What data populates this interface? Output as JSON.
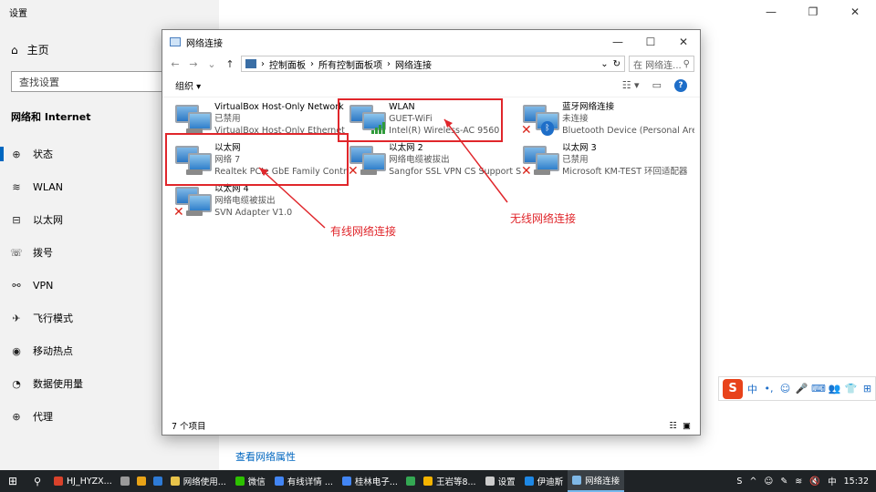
{
  "settings": {
    "title": "设置",
    "home_label": "主页",
    "search_placeholder": "查找设置",
    "section_title": "网络和 Internet",
    "nav": [
      {
        "icon": "globe-status-icon",
        "glyph": "⊕",
        "label": "状态"
      },
      {
        "icon": "wifi-icon",
        "glyph": "≋",
        "label": "WLAN"
      },
      {
        "icon": "ethernet-icon",
        "glyph": "⊟",
        "label": "以太网"
      },
      {
        "icon": "dialup-icon",
        "glyph": "☏",
        "label": "拨号"
      },
      {
        "icon": "vpn-icon",
        "glyph": "⚯",
        "label": "VPN"
      },
      {
        "icon": "airplane-icon",
        "glyph": "✈",
        "label": "飞行模式"
      },
      {
        "icon": "hotspot-icon",
        "glyph": "◉",
        "label": "移动热点"
      },
      {
        "icon": "data-usage-icon",
        "glyph": "◔",
        "label": "数据使用量"
      },
      {
        "icon": "proxy-icon",
        "glyph": "⊕",
        "label": "代理"
      }
    ],
    "link": "查看网络属性"
  },
  "net_window": {
    "title": "网络连接",
    "breadcrumb": [
      "控制面板",
      "所有控制面板项",
      "网络连接"
    ],
    "search_placeholder": "在 网络连...",
    "organize": "组织 ▾",
    "status_count": "7 个项目",
    "connections": [
      {
        "name": "VirtualBox Host-Only Network",
        "status": "已禁用",
        "device": "VirtualBox Host-Only Ethernet ...",
        "badge": "none"
      },
      {
        "name": "WLAN",
        "status": "GUET-WiFi",
        "device": "Intel(R) Wireless-AC 9560",
        "badge": "signal"
      },
      {
        "name": "蓝牙网络连接",
        "status": "未连接",
        "device": "Bluetooth Device (Personal Are...",
        "badge": "bluetooth"
      },
      {
        "name": "以太网",
        "status": "网络 7",
        "device": "Realtek PCIe GbE Family Contr...",
        "badge": "none"
      },
      {
        "name": "以太网 2",
        "status": "网络电缆被拔出",
        "device": "Sangfor SSL VPN CS Support S...",
        "badge": "x"
      },
      {
        "name": "以太网 3",
        "status": "已禁用",
        "device": "Microsoft KM-TEST 环回适配器",
        "badge": "x"
      },
      {
        "name": "以太网 4",
        "status": "网络电缆被拔出",
        "device": "SVN Adapter V1.0",
        "badge": "x"
      }
    ]
  },
  "annotations": {
    "wired_label": "有线网络连接",
    "wireless_label": "无线网络连接",
    "color": "#e0262b"
  },
  "ime": {
    "logo": "S",
    "items": [
      "中",
      "•,",
      "☺",
      "🎤",
      "⌨",
      "👥",
      "👕",
      "⊞"
    ]
  },
  "taskbar": {
    "tasks": [
      {
        "label": "HJ_HYZX...",
        "color": "#d9422b"
      },
      {
        "label": "",
        "color": "#9a9a9a"
      },
      {
        "label": "",
        "color": "#e8a317"
      },
      {
        "label": "",
        "color": "#2e7bd6"
      },
      {
        "label": "网络使用...",
        "color": "#e8c34a"
      },
      {
        "label": "微信",
        "color": "#2dc100"
      },
      {
        "label": "有线详情 ...",
        "color": "#4285f4"
      },
      {
        "label": "桂林电子...",
        "color": "#4285f4"
      },
      {
        "label": "",
        "color": "#34a853"
      },
      {
        "label": "王岩等8...",
        "color": "#f5b400"
      },
      {
        "label": "设置",
        "color": "#cccccc"
      },
      {
        "label": "伊迪斯",
        "color": "#1e88e5"
      },
      {
        "label": "网络连接",
        "color": "#7fb8e6"
      }
    ],
    "tray": [
      "S",
      "^",
      "☺",
      "✎",
      "≋",
      "🔇",
      "中"
    ],
    "time": "15:32"
  }
}
